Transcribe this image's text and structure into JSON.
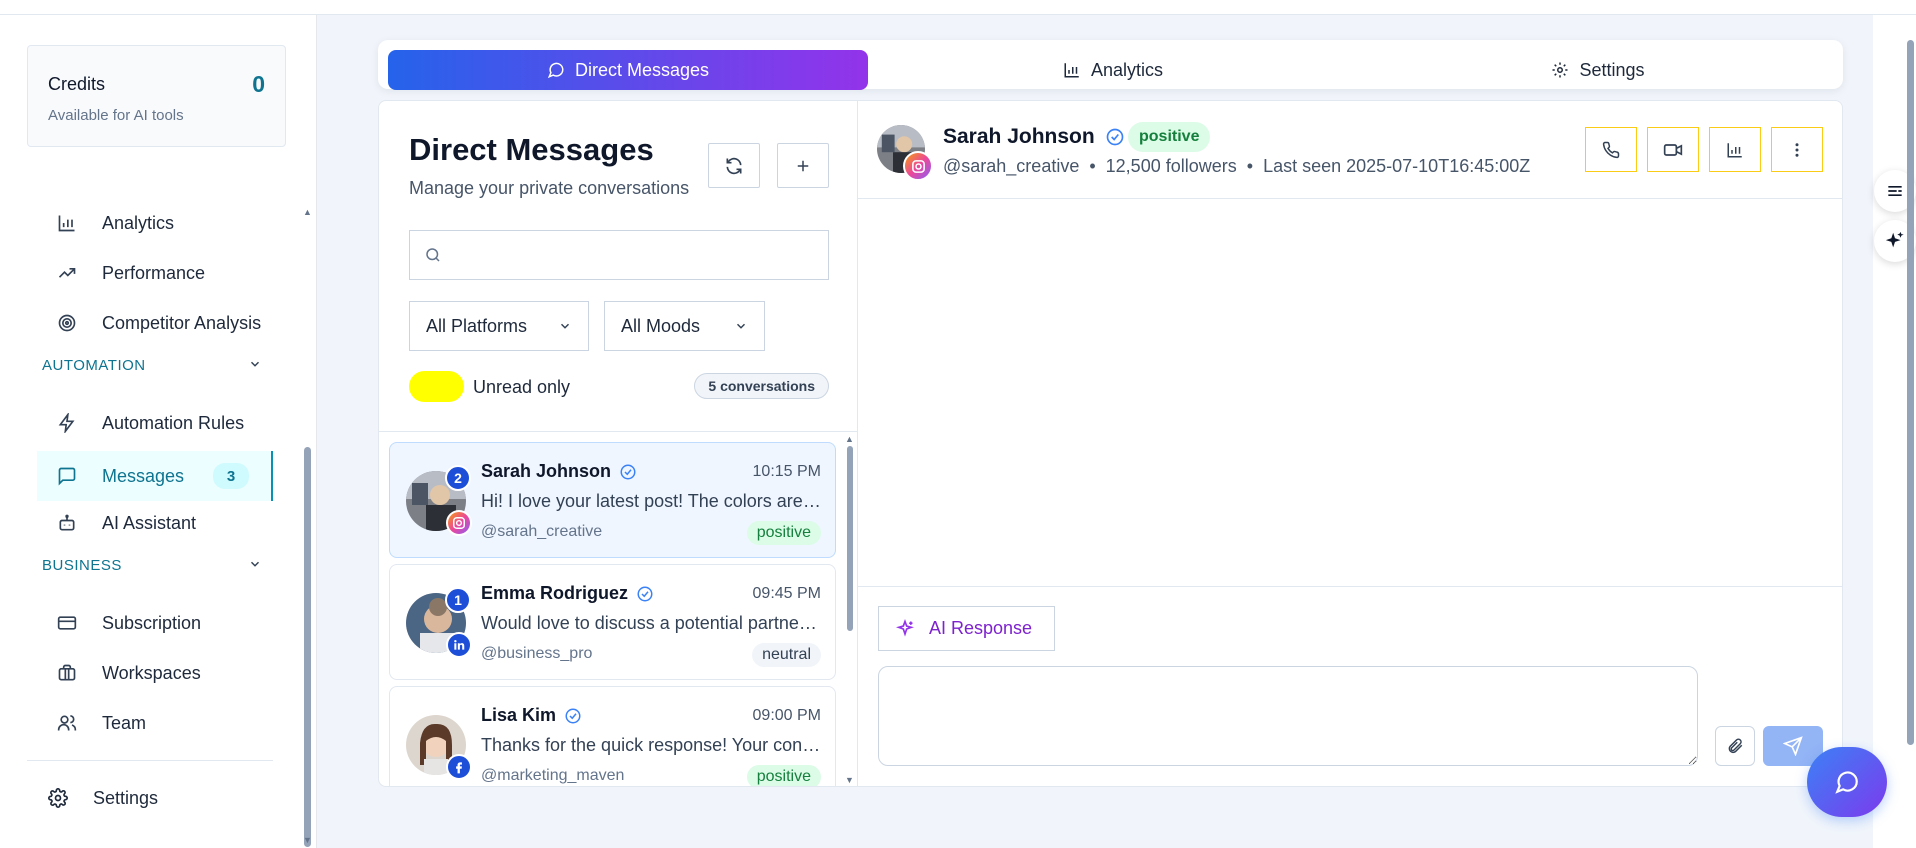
{
  "credits": {
    "title": "Credits",
    "value": "0",
    "subtitle": "Available for AI tools"
  },
  "sidebar": {
    "items": [
      {
        "label": "Analytics",
        "icon": "bar-chart-icon"
      },
      {
        "label": "Performance",
        "icon": "trending-up-icon"
      },
      {
        "label": "Competitor Analysis",
        "icon": "target-icon"
      },
      {
        "label": "Automation Rules",
        "icon": "zap-icon"
      },
      {
        "label": "Messages",
        "icon": "message-square-icon",
        "badge": "3"
      },
      {
        "label": "AI Assistant",
        "icon": "bot-icon"
      },
      {
        "label": "Subscription",
        "icon": "credit-card-icon"
      },
      {
        "label": "Workspaces",
        "icon": "briefcase-icon"
      },
      {
        "label": "Team",
        "icon": "users-icon"
      }
    ],
    "sections": {
      "automation": "AUTOMATION",
      "business": "BUSINESS"
    },
    "settings": "Settings"
  },
  "tabs": [
    {
      "label": "Direct Messages",
      "icon": "message-circle-icon"
    },
    {
      "label": "Analytics",
      "icon": "bar-chart-icon"
    },
    {
      "label": "Settings",
      "icon": "gear-icon"
    }
  ],
  "list": {
    "title": "Direct Messages",
    "subtitle": "Manage your private conversations",
    "search_placeholder": "",
    "platform_filter": "All Platforms",
    "mood_filter": "All Moods",
    "unread_only": "Unread only",
    "count": "5 conversations",
    "conversations": [
      {
        "name": "Sarah Johnson",
        "time": "10:15 PM",
        "message": "Hi! I love your latest post! The colors are amazing.",
        "handle": "@sarah_creative",
        "mood": "positive",
        "unread": "2",
        "platform": "instagram"
      },
      {
        "name": "Emma Rodriguez",
        "time": "09:45 PM",
        "message": "Would love to discuss a potential partnership.",
        "handle": "@business_pro",
        "mood": "neutral",
        "unread": "1",
        "platform": "linkedin"
      },
      {
        "name": "Lisa Kim",
        "time": "09:00 PM",
        "message": "Thanks for the quick response! Your content is great.",
        "handle": "@marketing_maven",
        "mood": "positive",
        "unread": "",
        "platform": "facebook"
      }
    ]
  },
  "chat": {
    "name": "Sarah Johnson",
    "mood": "positive",
    "handle": "@sarah_creative",
    "followers": "12,500 followers",
    "last_seen": "Last seen 2025-07-10T16:45:00Z",
    "ai_response": "AI Response",
    "composer_placeholder": ""
  },
  "colors": {
    "accent": "#0891b2",
    "primary_gradient_start": "#2563eb",
    "primary_gradient_end": "#9333ea",
    "toggle": "#ffff00",
    "header_btn_border": "#facc15"
  }
}
